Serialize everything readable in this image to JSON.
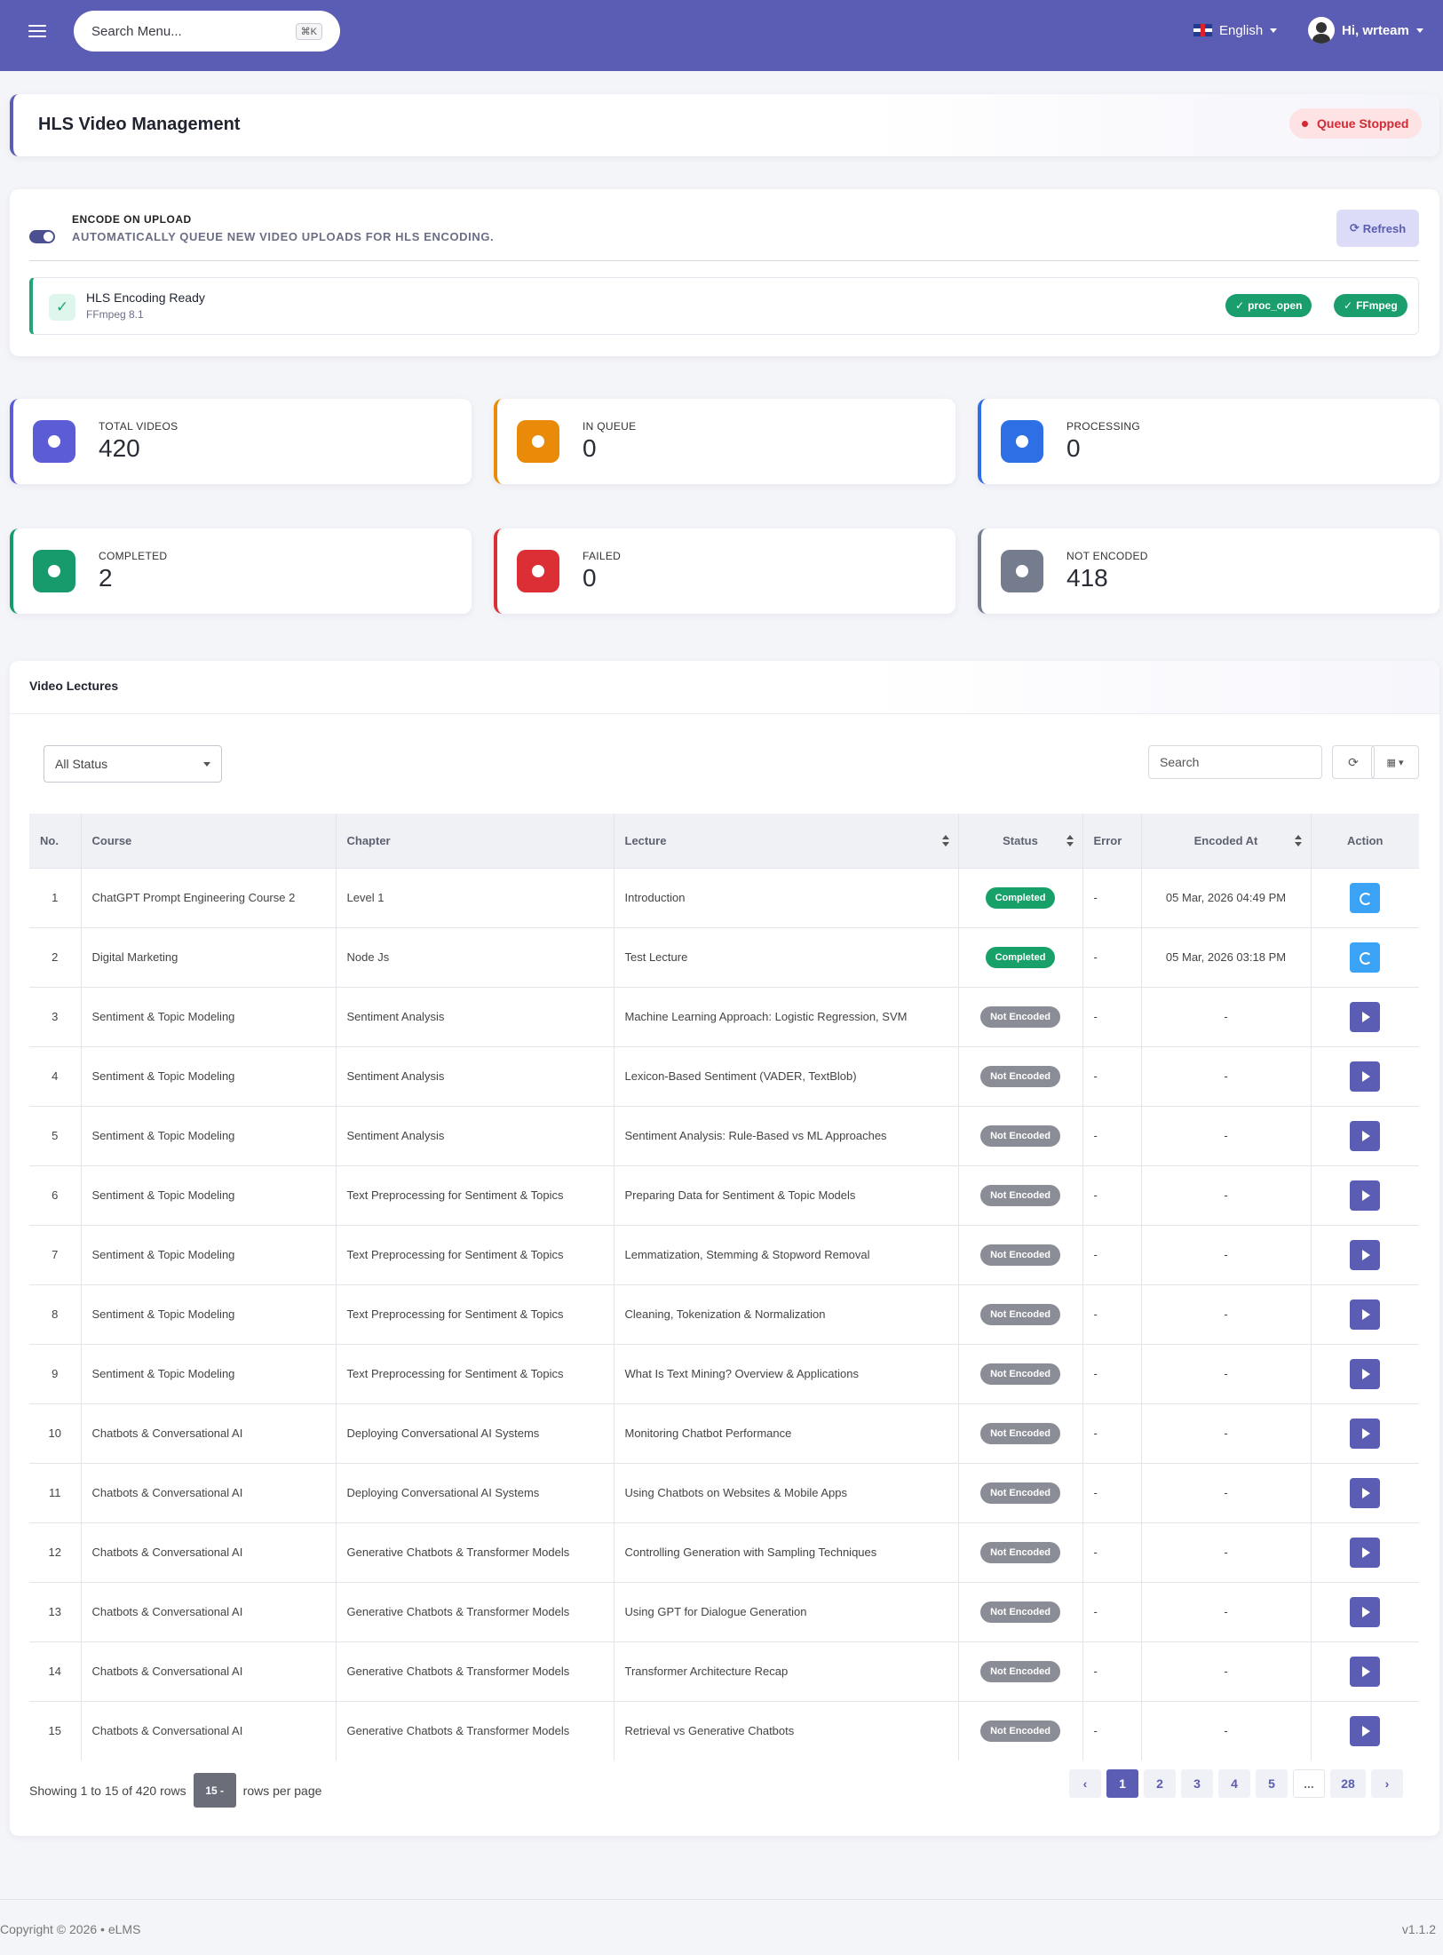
{
  "topbar": {
    "search_placeholder": "Search Menu...",
    "shortcut": "⌘K",
    "language": "English",
    "user_greeting": "Hi, wrteam"
  },
  "page": {
    "title": "HLS Video Management",
    "queue_status": "Queue Stopped"
  },
  "encode": {
    "title": "ENCODE ON UPLOAD",
    "subtitle": "AUTOMATICALLY QUEUE NEW VIDEO UPLOADS FOR HLS ENCODING.",
    "enabled": true,
    "refresh_label": "Refresh",
    "ready_title": "HLS Encoding Ready",
    "ready_sub": "FFmpeg 8.1",
    "badges": [
      "proc_open",
      "FFmpeg"
    ]
  },
  "stats": [
    {
      "label": "TOTAL VIDEOS",
      "value": "420",
      "color": "#5b5cd6",
      "icon": "video-icon"
    },
    {
      "label": "IN QUEUE",
      "value": "0",
      "color": "#e98a09",
      "icon": "clock-icon"
    },
    {
      "label": "PROCESSING",
      "value": "0",
      "color": "#2f6fe6",
      "icon": "gear-icon"
    },
    {
      "label": "COMPLETED",
      "value": "2",
      "color": "#179a6c",
      "icon": "check-circle-icon"
    },
    {
      "label": "FAILED",
      "value": "0",
      "color": "#dc2f35",
      "icon": "x-circle-icon"
    },
    {
      "label": "NOT ENCODED",
      "value": "418",
      "color": "#757c8e",
      "icon": "minus-circle-icon"
    }
  ],
  "lectures": {
    "title": "Video Lectures",
    "filter_value": "All Status",
    "search_placeholder": "Search",
    "columns": [
      "No.",
      "Course",
      "Chapter",
      "Lecture",
      "Status",
      "Error",
      "Encoded At",
      "Action"
    ],
    "rows": [
      {
        "no": "1",
        "course": "ChatGPT Prompt Engineering Course 2",
        "chapter": "Level 1",
        "lecture": "Introduction",
        "status": "Completed",
        "error": "-",
        "encoded_at": "05 Mar, 2026 04:49 PM",
        "action": "re-encode"
      },
      {
        "no": "2",
        "course": "Digital Marketing",
        "chapter": "Node Js",
        "lecture": "Test Lecture",
        "status": "Completed",
        "error": "-",
        "encoded_at": "05 Mar, 2026 03:18 PM",
        "action": "re-encode"
      },
      {
        "no": "3",
        "course": "Sentiment & Topic Modeling",
        "chapter": "Sentiment Analysis",
        "lecture": "Machine Learning Approach: Logistic Regression, SVM",
        "status": "Not Encoded",
        "error": "-",
        "encoded_at": "-",
        "action": "encode"
      },
      {
        "no": "4",
        "course": "Sentiment & Topic Modeling",
        "chapter": "Sentiment Analysis",
        "lecture": "Lexicon-Based Sentiment (VADER, TextBlob)",
        "status": "Not Encoded",
        "error": "-",
        "encoded_at": "-",
        "action": "encode"
      },
      {
        "no": "5",
        "course": "Sentiment & Topic Modeling",
        "chapter": "Sentiment Analysis",
        "lecture": "Sentiment Analysis: Rule-Based vs ML Approaches",
        "status": "Not Encoded",
        "error": "-",
        "encoded_at": "-",
        "action": "encode"
      },
      {
        "no": "6",
        "course": "Sentiment & Topic Modeling",
        "chapter": "Text Preprocessing for Sentiment & Topics",
        "lecture": "Preparing Data for Sentiment & Topic Models",
        "status": "Not Encoded",
        "error": "-",
        "encoded_at": "-",
        "action": "encode"
      },
      {
        "no": "7",
        "course": "Sentiment & Topic Modeling",
        "chapter": "Text Preprocessing for Sentiment & Topics",
        "lecture": "Lemmatization, Stemming & Stopword Removal",
        "status": "Not Encoded",
        "error": "-",
        "encoded_at": "-",
        "action": "encode"
      },
      {
        "no": "8",
        "course": "Sentiment & Topic Modeling",
        "chapter": "Text Preprocessing for Sentiment & Topics",
        "lecture": "Cleaning, Tokenization & Normalization",
        "status": "Not Encoded",
        "error": "-",
        "encoded_at": "-",
        "action": "encode"
      },
      {
        "no": "9",
        "course": "Sentiment & Topic Modeling",
        "chapter": "Text Preprocessing for Sentiment & Topics",
        "lecture": "What Is Text Mining? Overview & Applications",
        "status": "Not Encoded",
        "error": "-",
        "encoded_at": "-",
        "action": "encode"
      },
      {
        "no": "10",
        "course": "Chatbots & Conversational AI",
        "chapter": "Deploying Conversational AI Systems",
        "lecture": "Monitoring Chatbot Performance",
        "status": "Not Encoded",
        "error": "-",
        "encoded_at": "-",
        "action": "encode"
      },
      {
        "no": "11",
        "course": "Chatbots & Conversational AI",
        "chapter": "Deploying Conversational AI Systems",
        "lecture": "Using Chatbots on Websites & Mobile Apps",
        "status": "Not Encoded",
        "error": "-",
        "encoded_at": "-",
        "action": "encode"
      },
      {
        "no": "12",
        "course": "Chatbots & Conversational AI",
        "chapter": "Generative Chatbots & Transformer Models",
        "lecture": "Controlling Generation with Sampling Techniques",
        "status": "Not Encoded",
        "error": "-",
        "encoded_at": "-",
        "action": "encode"
      },
      {
        "no": "13",
        "course": "Chatbots & Conversational AI",
        "chapter": "Generative Chatbots & Transformer Models",
        "lecture": "Using GPT for Dialogue Generation",
        "status": "Not Encoded",
        "error": "-",
        "encoded_at": "-",
        "action": "encode"
      },
      {
        "no": "14",
        "course": "Chatbots & Conversational AI",
        "chapter": "Generative Chatbots & Transformer Models",
        "lecture": "Transformer Architecture Recap",
        "status": "Not Encoded",
        "error": "-",
        "encoded_at": "-",
        "action": "encode"
      },
      {
        "no": "15",
        "course": "Chatbots & Conversational AI",
        "chapter": "Generative Chatbots & Transformer Models",
        "lecture": "Retrieval vs Generative Chatbots",
        "status": "Not Encoded",
        "error": "-",
        "encoded_at": "-",
        "action": "encode"
      }
    ],
    "pagination": {
      "info": "Showing 1 to 15 of 420 rows",
      "per_page": "15 -",
      "per_page_suffix": "rows per page",
      "prev": "‹",
      "pages": [
        "1",
        "2",
        "3",
        "4",
        "5",
        "...",
        "28"
      ],
      "next": "›",
      "active": "1"
    }
  },
  "footer": {
    "copyright": "Copyright © 2026  •  eLMS",
    "version": "v1.1.2"
  }
}
